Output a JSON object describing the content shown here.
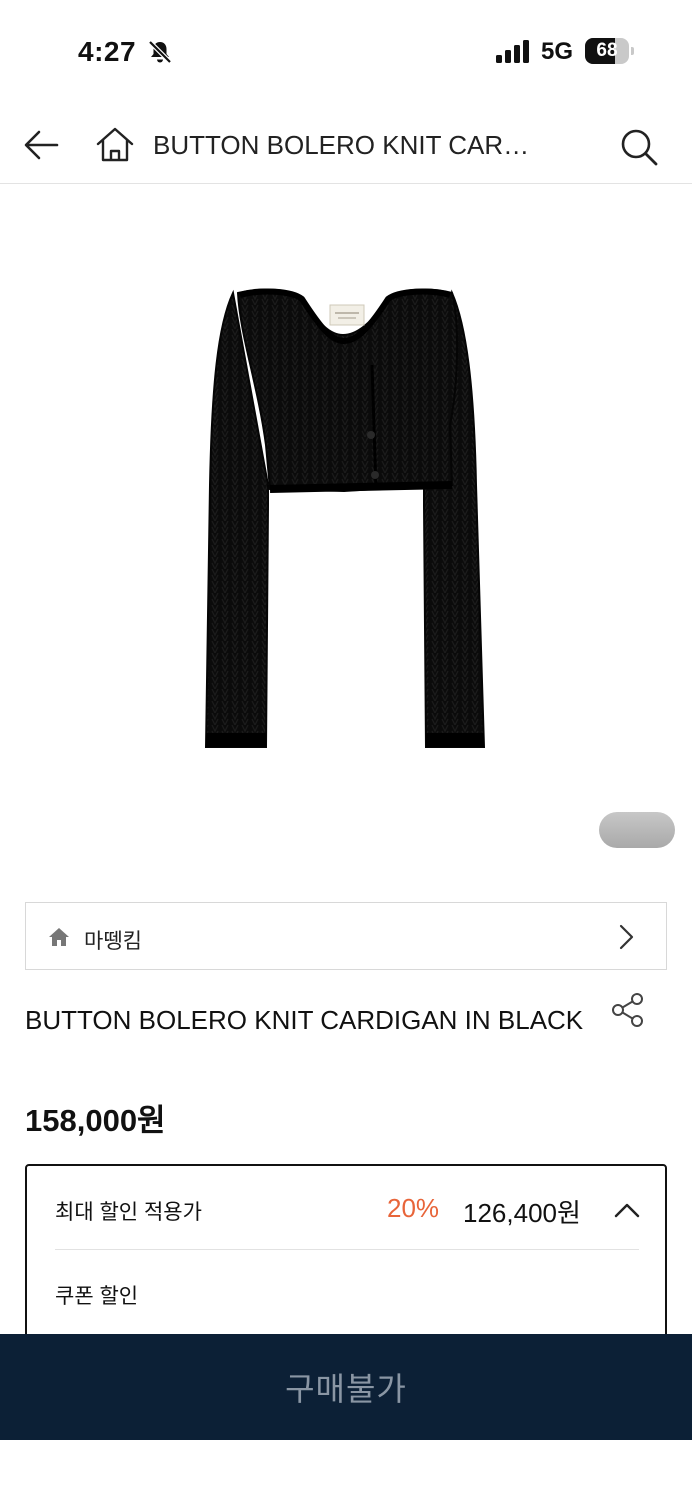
{
  "status_bar": {
    "time": "4:27",
    "network": "5G",
    "battery": "68",
    "battery_level": 0.68
  },
  "header": {
    "title": "BUTTON BOLERO KNIT CARDIGAN IN BLACK",
    "back_icon": "arrow-left-icon",
    "home_icon": "home-outline-icon",
    "search_icon": "search-icon"
  },
  "gallery": {
    "image_alt": "black cropped bolero knit cardigan"
  },
  "brand": {
    "name": "마뗑킴",
    "icon": "home-filled-icon"
  },
  "product": {
    "title": "BUTTON BOLERO KNIT CARDIGAN IN BLACK",
    "price": "158,000원",
    "share_icon": "share-icon"
  },
  "discount": {
    "label": "최대 할인 적용가",
    "rate": "20%",
    "final_price": "126,400원",
    "coupon_label": "쿠폰 할인",
    "accent_color": "#e8653a"
  },
  "buy_bar": {
    "label": "구매불가",
    "background": "#0c2036"
  }
}
